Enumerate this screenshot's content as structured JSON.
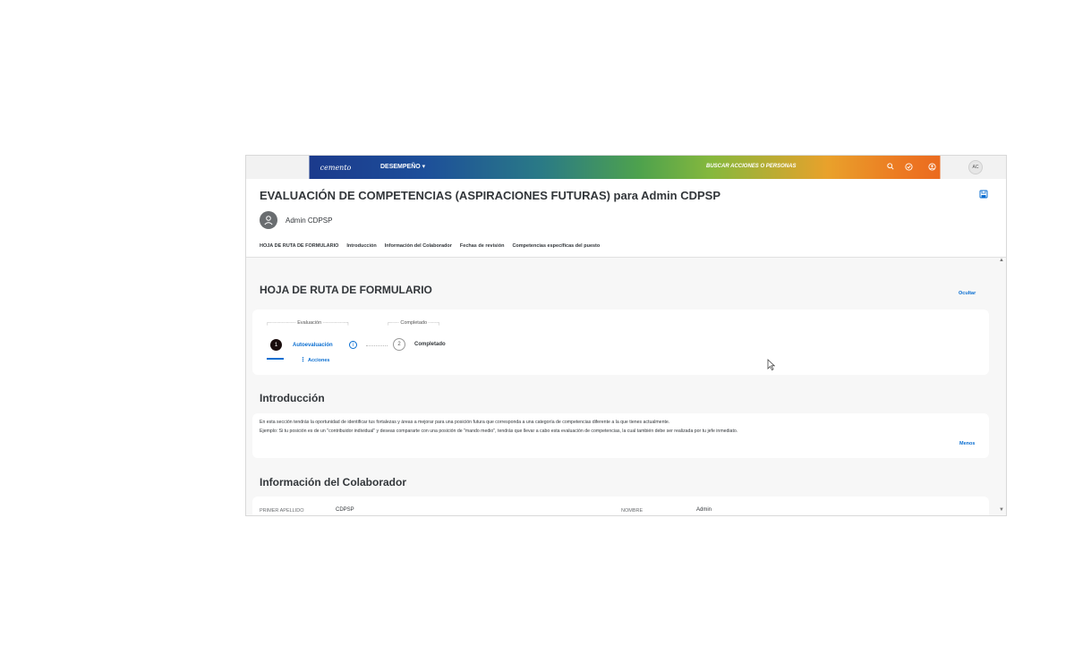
{
  "topbar": {
    "brand": "cemento",
    "menu_label": "DESEMPEÑO ▾",
    "search_text": "BUSCAR ACCIONES O PERSONAS",
    "icons": [
      "search-icon",
      "check-circle-icon",
      "notification-icon"
    ],
    "user_initials": "AC"
  },
  "header": {
    "title": "EVALUACIÓN DE COMPETENCIAS (ASPIRACIONES FUTURAS) para Admin CDPSP",
    "user_name": "Admin CDPSP",
    "nav": [
      "HOJA DE RUTA DE FORMULARIO",
      "Introducción",
      "Información del Colaborador",
      "Fechas de revisión",
      "Competencias específicas del puesto"
    ]
  },
  "roadmap": {
    "title": "HOJA DE RUTA DE FORMULARIO",
    "hide_link": "Ocultar",
    "phases": [
      "Evaluación",
      "Completado"
    ],
    "steps": [
      {
        "number": "1",
        "label": "Autoevaluación"
      },
      {
        "number": "2",
        "label": "Completado"
      }
    ],
    "actions_label": "Acciones"
  },
  "intro": {
    "title": "Introducción",
    "line1": "En esta sección tendrás la oportunidad de identificar tus fortalezas y áreas a mejorar para una posición futura que corresponda a una categoría de competencias diferente a la que tienes actualmente.",
    "line2": "Ejemplo: Si tu posición es de un \"contribuidor individual\" y deseas compararte con una posición de \"mando medio\", tendrás que llevar a cabo esta evaluación de competencias, la cual también debe ser realizada por tu jefe inmediato.",
    "less_link": "Menos"
  },
  "collaborator": {
    "title": "Información del Colaborador",
    "fields": [
      {
        "label": "PRIMER APELLIDO",
        "value": "CDPSP"
      },
      {
        "label": "NOMBRE",
        "value": "Admin"
      }
    ]
  }
}
